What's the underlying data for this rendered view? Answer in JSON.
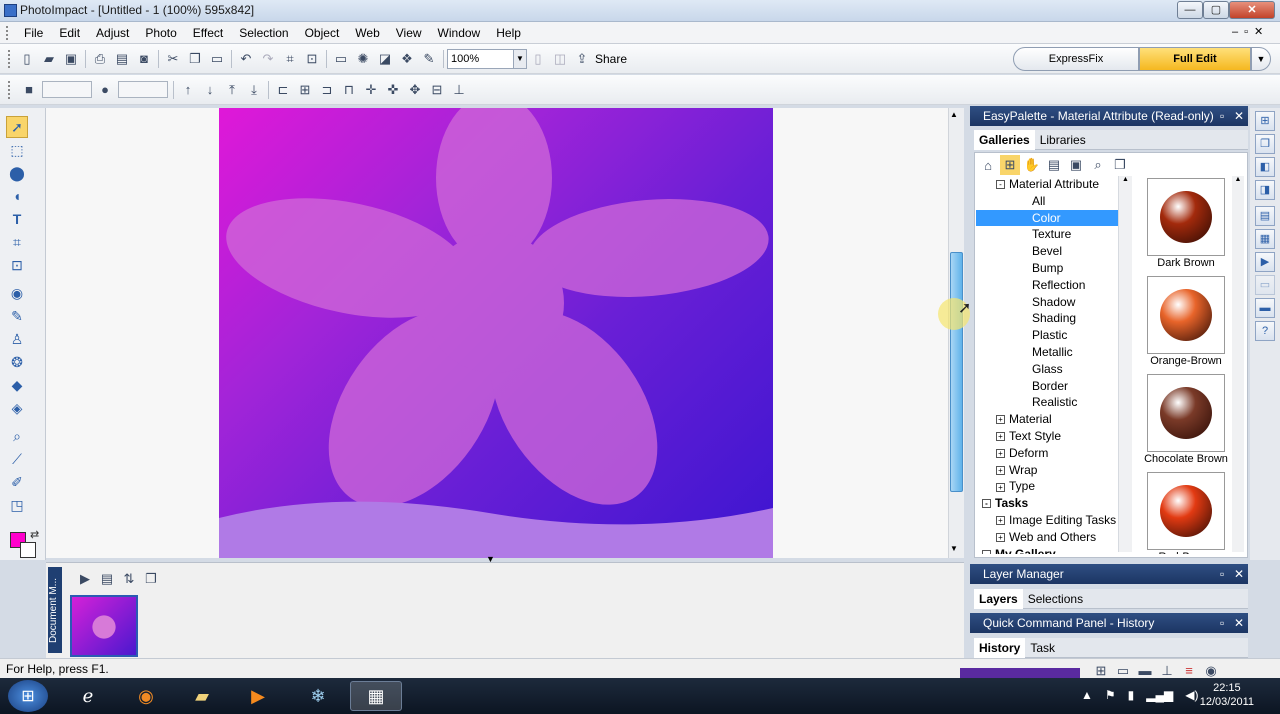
{
  "window": {
    "title": "PhotoImpact - [Untitled - 1 (100%) 595x842]",
    "minimize": "—",
    "maximize": "▢",
    "close": "✕"
  },
  "menu": [
    "File",
    "Edit",
    "Adjust",
    "Photo",
    "Effect",
    "Selection",
    "Object",
    "Web",
    "View",
    "Window",
    "Help"
  ],
  "toolbar": {
    "zoom_value": "100%",
    "share_label": "Share"
  },
  "modes": {
    "expressfix": "ExpressFix",
    "fulledit": "Full Edit"
  },
  "colors": {
    "foreground": "#ff00cc",
    "background": "#ffffff",
    "accent": "#f5c234"
  },
  "easypalette": {
    "title": "EasyPalette - Material Attribute (Read-only)",
    "tabs": [
      "Galleries",
      "Libraries"
    ],
    "tree": [
      {
        "label": "Material Attribute",
        "level": 1,
        "expander": "-"
      },
      {
        "label": "All",
        "level": 2
      },
      {
        "label": "Color",
        "level": 2,
        "selected": true
      },
      {
        "label": "Texture",
        "level": 2
      },
      {
        "label": "Bevel",
        "level": 2
      },
      {
        "label": "Bump",
        "level": 2
      },
      {
        "label": "Reflection",
        "level": 2
      },
      {
        "label": "Shadow",
        "level": 2
      },
      {
        "label": "Shading",
        "level": 2
      },
      {
        "label": "Plastic",
        "level": 2
      },
      {
        "label": "Metallic",
        "level": 2
      },
      {
        "label": "Glass",
        "level": 2
      },
      {
        "label": "Border",
        "level": 2
      },
      {
        "label": "Realistic",
        "level": 2
      },
      {
        "label": "Material",
        "level": 1,
        "expander": "+"
      },
      {
        "label": "Text Style",
        "level": 1,
        "expander": "+"
      },
      {
        "label": "Deform",
        "level": 1,
        "expander": "+"
      },
      {
        "label": "Wrap",
        "level": 1,
        "expander": "+"
      },
      {
        "label": "Type",
        "level": 1,
        "expander": "+"
      },
      {
        "label": "Tasks",
        "level": 0,
        "expander": "-",
        "bold": true
      },
      {
        "label": "Image Editing Tasks",
        "level": 1,
        "expander": "+"
      },
      {
        "label": "Web and Others",
        "level": 1,
        "expander": "+"
      },
      {
        "label": "My Gallery",
        "level": 0,
        "expander": "-",
        "bold": true
      }
    ],
    "swatches": [
      {
        "label": "Dark Brown",
        "color": "#a32a0c"
      },
      {
        "label": "Orange-Brown",
        "color": "#e8642a"
      },
      {
        "label": "Chocolate Brown",
        "color": "#7a3a28"
      },
      {
        "label": "Red-Brown",
        "color": "#e23a12"
      }
    ]
  },
  "layer_manager": {
    "title": "Layer Manager",
    "tabs": [
      "Layers",
      "Selections"
    ]
  },
  "quick_command": {
    "title": "Quick Command Panel - History",
    "tabs": [
      "History",
      "Task"
    ]
  },
  "doc_manager": {
    "tab_label": "Document M..."
  },
  "status": {
    "help_text": "For Help, press F1."
  },
  "taskbar": {
    "time": "22:15",
    "date": "12/03/2011"
  }
}
